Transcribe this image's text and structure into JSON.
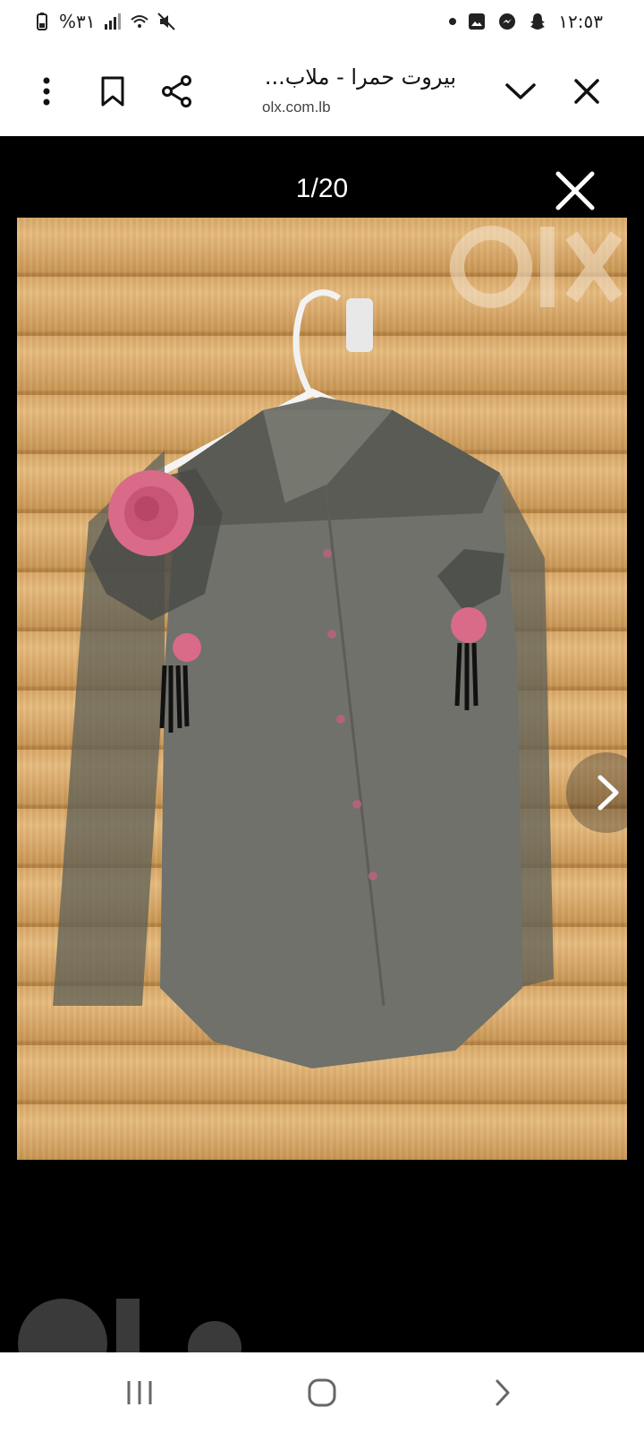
{
  "status_bar": {
    "battery": "%٣١",
    "time": "١٢:٥٣"
  },
  "browser": {
    "title": "بيروت حمرا - ملاب...",
    "domain": "olx.com.lb"
  },
  "viewer": {
    "counter": "1/20"
  },
  "watermark": "olx"
}
